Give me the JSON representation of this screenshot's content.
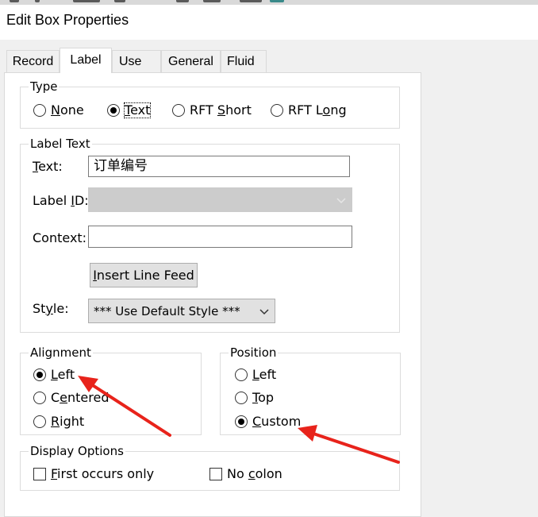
{
  "window": {
    "title": "Edit Box Properties"
  },
  "tabs": [
    {
      "label": "Record",
      "active": false
    },
    {
      "label": "Label",
      "active": true
    },
    {
      "label": "Use",
      "active": false
    },
    {
      "label": "General",
      "active": false
    },
    {
      "label": "Fluid",
      "active": false
    }
  ],
  "type_group": {
    "legend": "Type",
    "options": [
      {
        "pre": "",
        "key": "N",
        "post": "one",
        "selected": false
      },
      {
        "pre": "",
        "key": "T",
        "post": "ext",
        "selected": true
      },
      {
        "pre": "RFT ",
        "key": "S",
        "post": "hort",
        "selected": false
      },
      {
        "pre": "RFT L",
        "key": "o",
        "post": "ng",
        "selected": false
      }
    ]
  },
  "label_text_group": {
    "legend": "Label Text",
    "text": {
      "key": "T",
      "post": "ext:",
      "value": "订单编号"
    },
    "label_id": {
      "pre": "Label ",
      "key": "I",
      "post": "D:",
      "value": ""
    },
    "context": {
      "label": "Context:",
      "value": ""
    },
    "insert_button": {
      "key": "I",
      "post": "nsert Line Feed"
    },
    "style": {
      "pre": "St",
      "key": "y",
      "post": "le:",
      "value": "*** Use Default Style ***"
    }
  },
  "alignment_group": {
    "legend": "Alignment",
    "options": [
      {
        "pre": "",
        "key": "L",
        "post": "eft",
        "selected": true
      },
      {
        "pre": "C",
        "key": "e",
        "post": "ntered",
        "selected": false
      },
      {
        "pre": "",
        "key": "R",
        "post": "ight",
        "selected": false
      }
    ]
  },
  "position_group": {
    "legend": "Position",
    "options": [
      {
        "pre": "",
        "key": "L",
        "post": "eft",
        "selected": false
      },
      {
        "pre": "",
        "key": "T",
        "post": "op",
        "selected": false
      },
      {
        "pre": "",
        "key": "C",
        "post": "ustom",
        "selected": true
      }
    ]
  },
  "display_options_group": {
    "legend": "Display Options",
    "first_occurs": {
      "key": "F",
      "post": "irst occurs only",
      "checked": false
    },
    "no_colon": {
      "pre": "No ",
      "key": "c",
      "post": "olon",
      "checked": false
    }
  },
  "annotation_color": "#e8231b"
}
